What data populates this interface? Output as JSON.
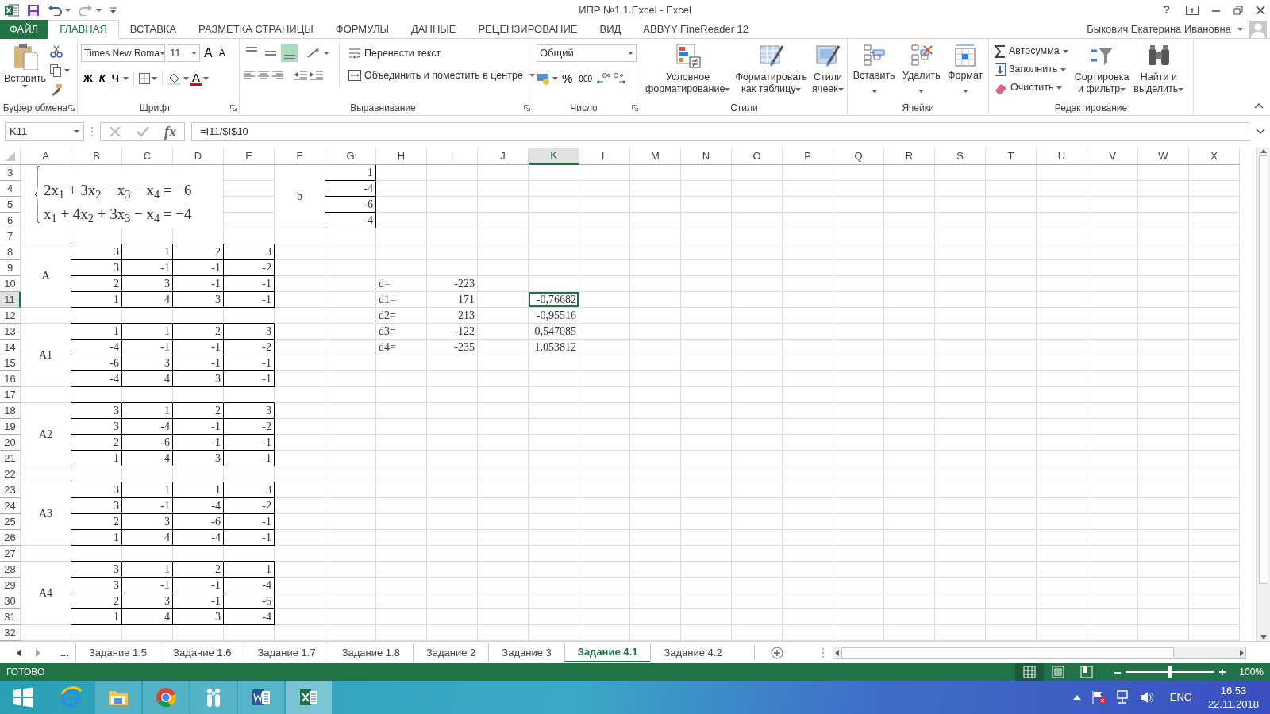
{
  "title_bar": {
    "title": "ИПР №1.1.Excel - Excel",
    "help": "?"
  },
  "ribbon_tabs": [
    {
      "label": "ФАЙЛ",
      "kind": "file",
      "selected": false
    },
    {
      "label": "ГЛАВНАЯ",
      "kind": "tab",
      "selected": true
    },
    {
      "label": "ВСТАВКА",
      "kind": "tab",
      "selected": false
    },
    {
      "label": "РАЗМЕТКА СТРАНИЦЫ",
      "kind": "tab",
      "selected": false
    },
    {
      "label": "ФОРМУЛЫ",
      "kind": "tab",
      "selected": false
    },
    {
      "label": "ДАННЫЕ",
      "kind": "tab",
      "selected": false
    },
    {
      "label": "РЕЦЕНЗИРОВАНИЕ",
      "kind": "tab",
      "selected": false
    },
    {
      "label": "ВИД",
      "kind": "tab",
      "selected": false
    },
    {
      "label": "ABBYY FineReader 12",
      "kind": "tab",
      "selected": false
    }
  ],
  "user": {
    "name": "Быкович Екатерина Ивановна"
  },
  "ribbon": {
    "clipboard": {
      "label": "Буфер обмена",
      "paste": "Вставить"
    },
    "font": {
      "label": "Шрифт",
      "font_name": "Times New Roma",
      "font_size": "11",
      "grow": "A",
      "shrink": "A",
      "bold": "Ж",
      "italic": "К",
      "underline": "Ч",
      "font_color": "A"
    },
    "alignment": {
      "label": "Выравнивание",
      "wrap": "Перенести текст",
      "merge": "Объединить и поместить в центре",
      "vertical_align": [
        {
          "selected": false
        },
        {
          "selected": false
        },
        {
          "selected": true
        }
      ]
    },
    "number": {
      "label": "Число",
      "format": "Общий",
      "percent": "%",
      "thousands": "000"
    },
    "styles": {
      "label": "Стили",
      "buttons": [
        [
          "Условное",
          "форматирование"
        ],
        [
          "Форматировать",
          "как таблицу"
        ],
        [
          "Стили",
          "ячеек"
        ]
      ]
    },
    "cells": {
      "label": "Ячейки",
      "buttons": [
        "Вставить",
        "Удалить",
        "Формат"
      ]
    },
    "editing": {
      "label": "Редактирование",
      "small": [
        "Автосумма",
        "Заполнить",
        "Очистить"
      ],
      "large": [
        [
          "Сортировка",
          "и фильтр"
        ],
        [
          "Найти и",
          "выделить"
        ]
      ]
    }
  },
  "formula_bar": {
    "name_box": "K11",
    "fx": "fx",
    "formula": "=I11/$I$10"
  },
  "sheet": {
    "columns": [
      {
        "label": "A",
        "selected": false
      },
      {
        "label": "B",
        "selected": false
      },
      {
        "label": "C",
        "selected": false
      },
      {
        "label": "D",
        "selected": false
      },
      {
        "label": "E",
        "selected": false
      },
      {
        "label": "F",
        "selected": false
      },
      {
        "label": "G",
        "selected": false
      },
      {
        "label": "H",
        "selected": false
      },
      {
        "label": "I",
        "selected": false
      },
      {
        "label": "J",
        "selected": false
      },
      {
        "label": "K",
        "selected": true
      },
      {
        "label": "L",
        "selected": false
      },
      {
        "label": "M",
        "selected": false
      },
      {
        "label": "N",
        "selected": false
      },
      {
        "label": "O",
        "selected": false
      },
      {
        "label": "P",
        "selected": false
      },
      {
        "label": "Q",
        "selected": false
      },
      {
        "label": "R",
        "selected": false
      },
      {
        "label": "S",
        "selected": false
      },
      {
        "label": "T",
        "selected": false
      },
      {
        "label": "U",
        "selected": false
      },
      {
        "label": "V",
        "selected": false
      },
      {
        "label": "W",
        "selected": false
      },
      {
        "label": "X",
        "selected": false
      }
    ],
    "rows": [
      {
        "label": "3",
        "selected": false
      },
      {
        "label": "4",
        "selected": false
      },
      {
        "label": "5",
        "selected": false
      },
      {
        "label": "6",
        "selected": false
      },
      {
        "label": "7",
        "selected": false
      },
      {
        "label": "8",
        "selected": false
      },
      {
        "label": "9",
        "selected": false
      },
      {
        "label": "10",
        "selected": false
      },
      {
        "label": "11",
        "selected": true
      },
      {
        "label": "12",
        "selected": false
      },
      {
        "label": "13",
        "selected": false
      },
      {
        "label": "14",
        "selected": false
      },
      {
        "label": "15",
        "selected": false
      },
      {
        "label": "16",
        "selected": false
      },
      {
        "label": "17",
        "selected": false
      },
      {
        "label": "18",
        "selected": false
      },
      {
        "label": "19",
        "selected": false
      },
      {
        "label": "20",
        "selected": false
      },
      {
        "label": "21",
        "selected": false
      },
      {
        "label": "22",
        "selected": false
      },
      {
        "label": "23",
        "selected": false
      },
      {
        "label": "24",
        "selected": false
      },
      {
        "label": "25",
        "selected": false
      },
      {
        "label": "26",
        "selected": false
      },
      {
        "label": "27",
        "selected": false
      },
      {
        "label": "28",
        "selected": false
      },
      {
        "label": "29",
        "selected": false
      },
      {
        "label": "30",
        "selected": false
      },
      {
        "label": "31",
        "selected": false
      },
      {
        "label": "32",
        "selected": false
      }
    ],
    "equation": {
      "lines": [
        "2x$_{1}$ + 3x$_{2}$ − x$_{3}$ − x$_{4}$ = −6",
        "x$_{1}$ + 4x$_{2}$ + 3x$_{3}$ − x$_{4}$ = −4"
      ]
    },
    "b_vector": {
      "label": "b",
      "values": [
        "1",
        "-4",
        "-6",
        "-4"
      ]
    },
    "matrices": [
      {
        "label": "A",
        "rows": [
          [
            "3",
            "1",
            "2",
            "3"
          ],
          [
            "3",
            "-1",
            "-1",
            "-2"
          ],
          [
            "2",
            "3",
            "-1",
            "-1"
          ],
          [
            "1",
            "4",
            "3",
            "-1"
          ]
        ]
      },
      {
        "label": "A1",
        "rows": [
          [
            "1",
            "1",
            "2",
            "3"
          ],
          [
            "-4",
            "-1",
            "-1",
            "-2"
          ],
          [
            "-6",
            "3",
            "-1",
            "-1"
          ],
          [
            "-4",
            "4",
            "3",
            "-1"
          ]
        ]
      },
      {
        "label": "A2",
        "rows": [
          [
            "3",
            "1",
            "2",
            "3"
          ],
          [
            "3",
            "-4",
            "-1",
            "-2"
          ],
          [
            "2",
            "-6",
            "-1",
            "-1"
          ],
          [
            "1",
            "-4",
            "3",
            "-1"
          ]
        ]
      },
      {
        "label": "A3",
        "rows": [
          [
            "3",
            "1",
            "1",
            "3"
          ],
          [
            "3",
            "-1",
            "-4",
            "-2"
          ],
          [
            "2",
            "3",
            "-6",
            "-1"
          ],
          [
            "1",
            "4",
            "-4",
            "-1"
          ]
        ]
      },
      {
        "label": "A4",
        "rows": [
          [
            "3",
            "1",
            "2",
            "1"
          ],
          [
            "3",
            "-1",
            "-1",
            "-4"
          ],
          [
            "2",
            "3",
            "-1",
            "-6"
          ],
          [
            "1",
            "4",
            "3",
            "-4"
          ]
        ]
      }
    ],
    "determinants": [
      {
        "label": "d=",
        "value": "-223",
        "selected": false
      },
      {
        "label": "d1=",
        "value": "171",
        "root": "-0,76682",
        "selected": true
      },
      {
        "label": "d2=",
        "value": "213",
        "root": "-0,95516",
        "selected": false
      },
      {
        "label": "d3=",
        "value": "-122",
        "root": "0,547085",
        "selected": false
      },
      {
        "label": "d4=",
        "value": "-235",
        "root": "1,053812",
        "selected": false
      }
    ]
  },
  "sheet_tabs": {
    "more": "...",
    "tabs": [
      {
        "label": "Задание 1.5",
        "selected": false
      },
      {
        "label": "Задание 1.6",
        "selected": false
      },
      {
        "label": "Задание 1.7",
        "selected": false
      },
      {
        "label": "Задание 1.8",
        "selected": false
      },
      {
        "label": "Задание 2",
        "selected": false
      },
      {
        "label": "Задание 3",
        "selected": false
      },
      {
        "label": "Задание 4.1",
        "selected": true
      },
      {
        "label": "Задание 4.2",
        "selected": false
      }
    ]
  },
  "status_bar": {
    "status": "ГОТОВО",
    "views": [
      {
        "selected": true
      },
      {
        "selected": false
      },
      {
        "selected": false
      }
    ],
    "zoom": {
      "level": 0.5
    },
    "zoom_text": "100%"
  },
  "taskbar": {
    "language": "ENG",
    "time": "16:53",
    "date": "22.11.2018"
  }
}
